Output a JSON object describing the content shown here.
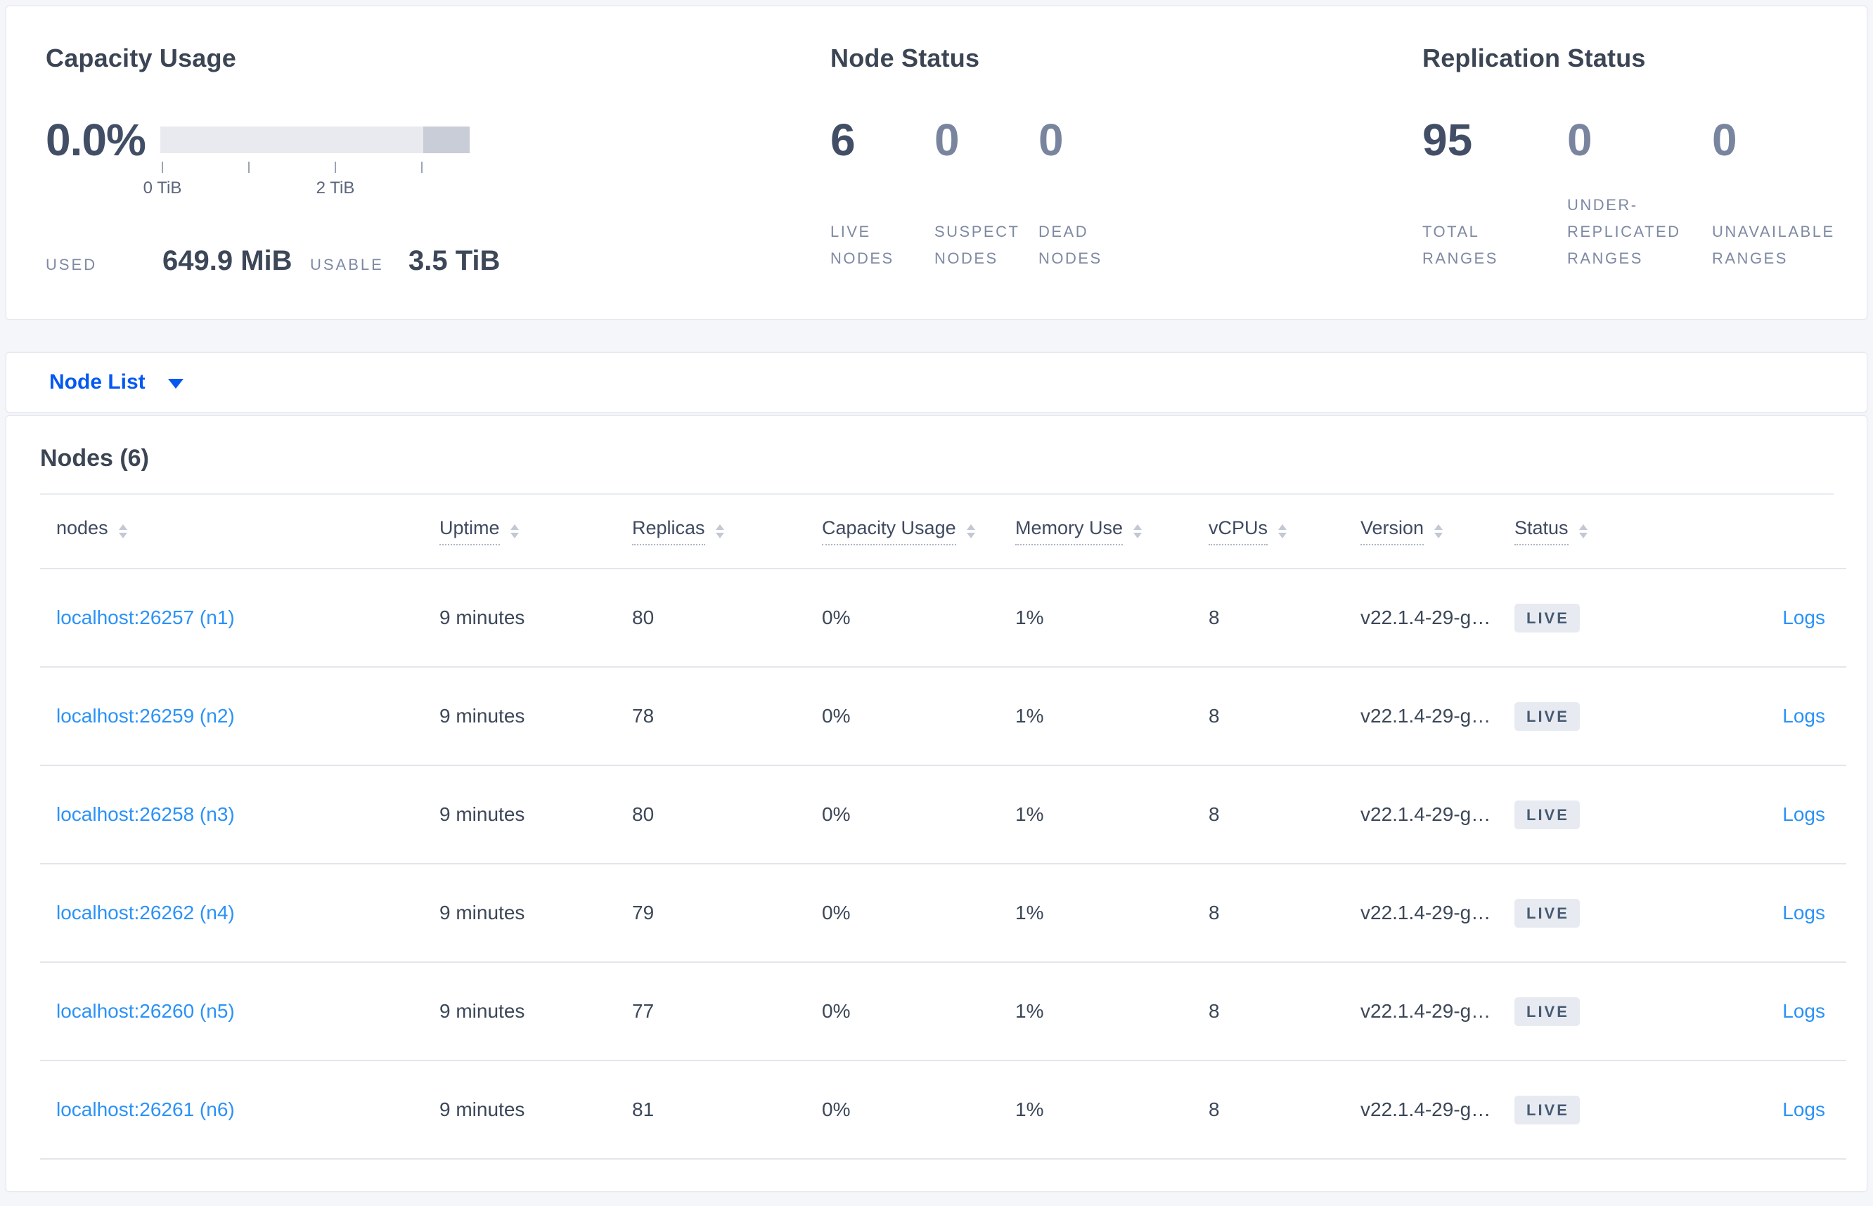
{
  "colors": {
    "accent_blue": "#0458f2",
    "link_blue": "#2b92f8",
    "page_bg": "#f4f6fa",
    "card_bg": "#ffffff",
    "badge_bg": "#e7ebf1",
    "bar_track": "#e8eaef",
    "bar_reserved_segment": "#c9cdd7",
    "big_number_dark": "#414e66",
    "big_number_light": "#79849f"
  },
  "summary": {
    "capacity": {
      "title": "Capacity Usage",
      "percent": "0.0%",
      "tick_labels": [
        "0 TiB",
        "2 TiB"
      ],
      "used_label": "USED",
      "used_value": "649.9 MiB",
      "usable_label": "USABLE",
      "usable_value": "3.5 TiB"
    },
    "node_status": {
      "title": "Node Status",
      "metrics": [
        {
          "value": "6",
          "label": "LIVE NODES"
        },
        {
          "value": "0",
          "label": "SUSPECT NODES"
        },
        {
          "value": "0",
          "label": "DEAD NODES"
        }
      ]
    },
    "replication": {
      "title": "Replication Status",
      "metrics": [
        {
          "value": "95",
          "label": "TOTAL RANGES"
        },
        {
          "value": "0",
          "label": "UNDER-REPLICATED RANGES"
        },
        {
          "value": "0",
          "label": "UNAVAILABLE RANGES"
        }
      ]
    }
  },
  "view_selector": {
    "label": "Node List"
  },
  "nodes_table": {
    "title": "Nodes (6)",
    "columns": {
      "nodes": "nodes",
      "uptime": "Uptime",
      "replicas": "Replicas",
      "capacity": "Capacity Usage",
      "memory": "Memory Use",
      "vcpus": "vCPUs",
      "version": "Version",
      "status": "Status"
    },
    "logs_label": "Logs",
    "rows": [
      {
        "address": "localhost:26257 (n1)",
        "uptime": "9 minutes",
        "replicas": "80",
        "capacity": "0%",
        "memory": "1%",
        "vcpus": "8",
        "version": "v22.1.4-29-g…",
        "status": "LIVE"
      },
      {
        "address": "localhost:26259 (n2)",
        "uptime": "9 minutes",
        "replicas": "78",
        "capacity": "0%",
        "memory": "1%",
        "vcpus": "8",
        "version": "v22.1.4-29-g…",
        "status": "LIVE"
      },
      {
        "address": "localhost:26258 (n3)",
        "uptime": "9 minutes",
        "replicas": "80",
        "capacity": "0%",
        "memory": "1%",
        "vcpus": "8",
        "version": "v22.1.4-29-g…",
        "status": "LIVE"
      },
      {
        "address": "localhost:26262 (n4)",
        "uptime": "9 minutes",
        "replicas": "79",
        "capacity": "0%",
        "memory": "1%",
        "vcpus": "8",
        "version": "v22.1.4-29-g…",
        "status": "LIVE"
      },
      {
        "address": "localhost:26260 (n5)",
        "uptime": "9 minutes",
        "replicas": "77",
        "capacity": "0%",
        "memory": "1%",
        "vcpus": "8",
        "version": "v22.1.4-29-g…",
        "status": "LIVE"
      },
      {
        "address": "localhost:26261 (n6)",
        "uptime": "9 minutes",
        "replicas": "81",
        "capacity": "0%",
        "memory": "1%",
        "vcpus": "8",
        "version": "v22.1.4-29-g…",
        "status": "LIVE"
      }
    ]
  }
}
